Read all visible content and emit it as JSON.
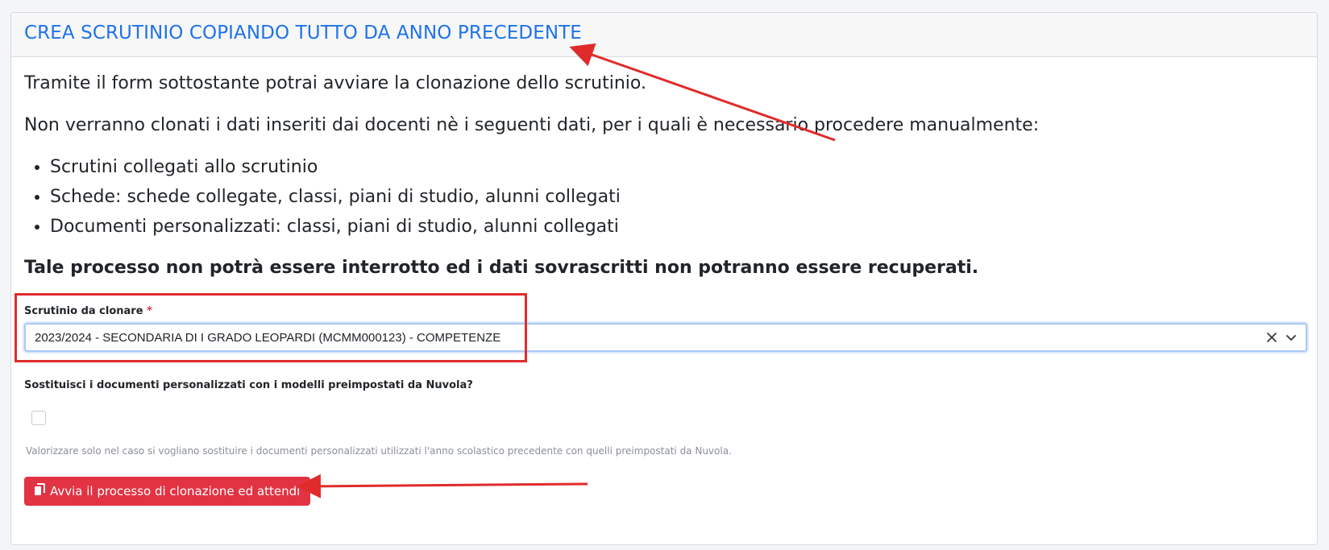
{
  "header": {
    "title": "CREA SCRUTINIO COPIANDO TUTTO DA ANNO PRECEDENTE"
  },
  "body": {
    "intro": "Tramite il form sottostante potrai avviare la clonazione dello scrutinio.",
    "note": "Non verranno clonati i dati inseriti dai docenti nè i seguenti dati, per i quali è necessario procedere manualmente:",
    "items": [
      "Scrutini collegati allo scrutinio",
      "Schede: schede collegate, classi, piani di studio, alunni collegati",
      "Documenti personalizzati: classi, piani di studio, alunni collegati"
    ],
    "warning": "Tale processo non potrà essere interrotto ed i dati sovrascritti non potranno essere recuperati."
  },
  "form": {
    "scrutinio_label": "Scrutinio da clonare",
    "required_mark": "*",
    "scrutinio_value": "2023/2024 - SECONDARIA DI I GRADO LEOPARDI (MCMM000123) - COMPETENZE",
    "replace_label": "Sostituisci i documenti personalizzati con i modelli preimpostati da Nuvola?",
    "replace_checked": false,
    "help_text": "Valorizzare solo nel caso si vogliano sostituire i documenti personalizzati utilizzati l'anno scolastico precedente con quelli preimpostati da Nuvola.",
    "submit_label": "Avvia il processo di clonazione ed attendi"
  },
  "colors": {
    "title": "#1e73e8",
    "danger": "#e23343",
    "annotation": "#e02b2b"
  }
}
